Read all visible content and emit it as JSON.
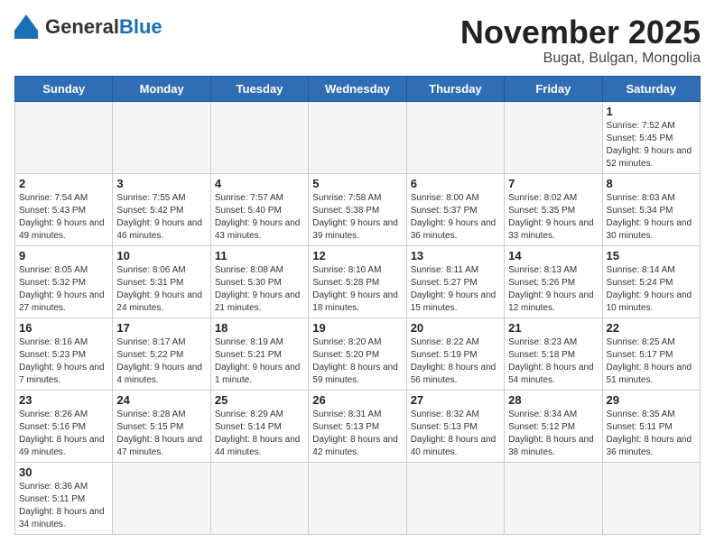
{
  "header": {
    "logo_general": "General",
    "logo_blue": "Blue",
    "title": "November 2025",
    "subtitle": "Bugat, Bulgan, Mongolia"
  },
  "days_of_week": [
    "Sunday",
    "Monday",
    "Tuesday",
    "Wednesday",
    "Thursday",
    "Friday",
    "Saturday"
  ],
  "weeks": [
    [
      {
        "day": null
      },
      {
        "day": null
      },
      {
        "day": null
      },
      {
        "day": null
      },
      {
        "day": null
      },
      {
        "day": null
      },
      {
        "day": 1,
        "sunrise": "7:52 AM",
        "sunset": "5:45 PM",
        "daylight": "9 hours and 52 minutes."
      }
    ],
    [
      {
        "day": 2,
        "sunrise": "7:54 AM",
        "sunset": "5:43 PM",
        "daylight": "9 hours and 49 minutes."
      },
      {
        "day": 3,
        "sunrise": "7:55 AM",
        "sunset": "5:42 PM",
        "daylight": "9 hours and 46 minutes."
      },
      {
        "day": 4,
        "sunrise": "7:57 AM",
        "sunset": "5:40 PM",
        "daylight": "9 hours and 43 minutes."
      },
      {
        "day": 5,
        "sunrise": "7:58 AM",
        "sunset": "5:38 PM",
        "daylight": "9 hours and 39 minutes."
      },
      {
        "day": 6,
        "sunrise": "8:00 AM",
        "sunset": "5:37 PM",
        "daylight": "9 hours and 36 minutes."
      },
      {
        "day": 7,
        "sunrise": "8:02 AM",
        "sunset": "5:35 PM",
        "daylight": "9 hours and 33 minutes."
      },
      {
        "day": 8,
        "sunrise": "8:03 AM",
        "sunset": "5:34 PM",
        "daylight": "9 hours and 30 minutes."
      }
    ],
    [
      {
        "day": 9,
        "sunrise": "8:05 AM",
        "sunset": "5:32 PM",
        "daylight": "9 hours and 27 minutes."
      },
      {
        "day": 10,
        "sunrise": "8:06 AM",
        "sunset": "5:31 PM",
        "daylight": "9 hours and 24 minutes."
      },
      {
        "day": 11,
        "sunrise": "8:08 AM",
        "sunset": "5:30 PM",
        "daylight": "9 hours and 21 minutes."
      },
      {
        "day": 12,
        "sunrise": "8:10 AM",
        "sunset": "5:28 PM",
        "daylight": "9 hours and 18 minutes."
      },
      {
        "day": 13,
        "sunrise": "8:11 AM",
        "sunset": "5:27 PM",
        "daylight": "9 hours and 15 minutes."
      },
      {
        "day": 14,
        "sunrise": "8:13 AM",
        "sunset": "5:26 PM",
        "daylight": "9 hours and 12 minutes."
      },
      {
        "day": 15,
        "sunrise": "8:14 AM",
        "sunset": "5:24 PM",
        "daylight": "9 hours and 10 minutes."
      }
    ],
    [
      {
        "day": 16,
        "sunrise": "8:16 AM",
        "sunset": "5:23 PM",
        "daylight": "9 hours and 7 minutes."
      },
      {
        "day": 17,
        "sunrise": "8:17 AM",
        "sunset": "5:22 PM",
        "daylight": "9 hours and 4 minutes."
      },
      {
        "day": 18,
        "sunrise": "8:19 AM",
        "sunset": "5:21 PM",
        "daylight": "9 hours and 1 minute."
      },
      {
        "day": 19,
        "sunrise": "8:20 AM",
        "sunset": "5:20 PM",
        "daylight": "8 hours and 59 minutes."
      },
      {
        "day": 20,
        "sunrise": "8:22 AM",
        "sunset": "5:19 PM",
        "daylight": "8 hours and 56 minutes."
      },
      {
        "day": 21,
        "sunrise": "8:23 AM",
        "sunset": "5:18 PM",
        "daylight": "8 hours and 54 minutes."
      },
      {
        "day": 22,
        "sunrise": "8:25 AM",
        "sunset": "5:17 PM",
        "daylight": "8 hours and 51 minutes."
      }
    ],
    [
      {
        "day": 23,
        "sunrise": "8:26 AM",
        "sunset": "5:16 PM",
        "daylight": "8 hours and 49 minutes."
      },
      {
        "day": 24,
        "sunrise": "8:28 AM",
        "sunset": "5:15 PM",
        "daylight": "8 hours and 47 minutes."
      },
      {
        "day": 25,
        "sunrise": "8:29 AM",
        "sunset": "5:14 PM",
        "daylight": "8 hours and 44 minutes."
      },
      {
        "day": 26,
        "sunrise": "8:31 AM",
        "sunset": "5:13 PM",
        "daylight": "8 hours and 42 minutes."
      },
      {
        "day": 27,
        "sunrise": "8:32 AM",
        "sunset": "5:13 PM",
        "daylight": "8 hours and 40 minutes."
      },
      {
        "day": 28,
        "sunrise": "8:34 AM",
        "sunset": "5:12 PM",
        "daylight": "8 hours and 38 minutes."
      },
      {
        "day": 29,
        "sunrise": "8:35 AM",
        "sunset": "5:11 PM",
        "daylight": "8 hours and 36 minutes."
      }
    ],
    [
      {
        "day": 30,
        "sunrise": "8:36 AM",
        "sunset": "5:11 PM",
        "daylight": "8 hours and 34 minutes."
      },
      {
        "day": null
      },
      {
        "day": null
      },
      {
        "day": null
      },
      {
        "day": null
      },
      {
        "day": null
      },
      {
        "day": null
      }
    ]
  ]
}
